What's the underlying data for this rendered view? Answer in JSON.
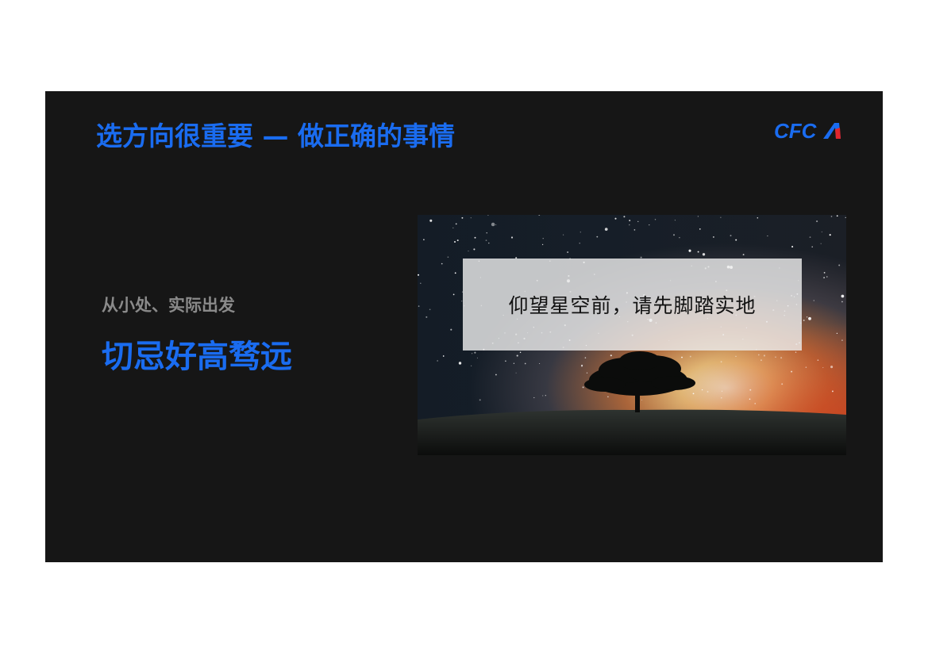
{
  "slide": {
    "title": "选方向很重要 — 做正确的事情",
    "logo_text": "CFCA",
    "subtitle": "从小处、实际出发",
    "headline": "切忌好高骛远",
    "photo": {
      "caption": "仰望星空前，请先脚踏实地",
      "icon": "starry-sky-tree-image"
    },
    "colors": {
      "accent": "#1a6cf0",
      "slide_background": "#161616",
      "subtitle": "#8a8a8a"
    }
  }
}
